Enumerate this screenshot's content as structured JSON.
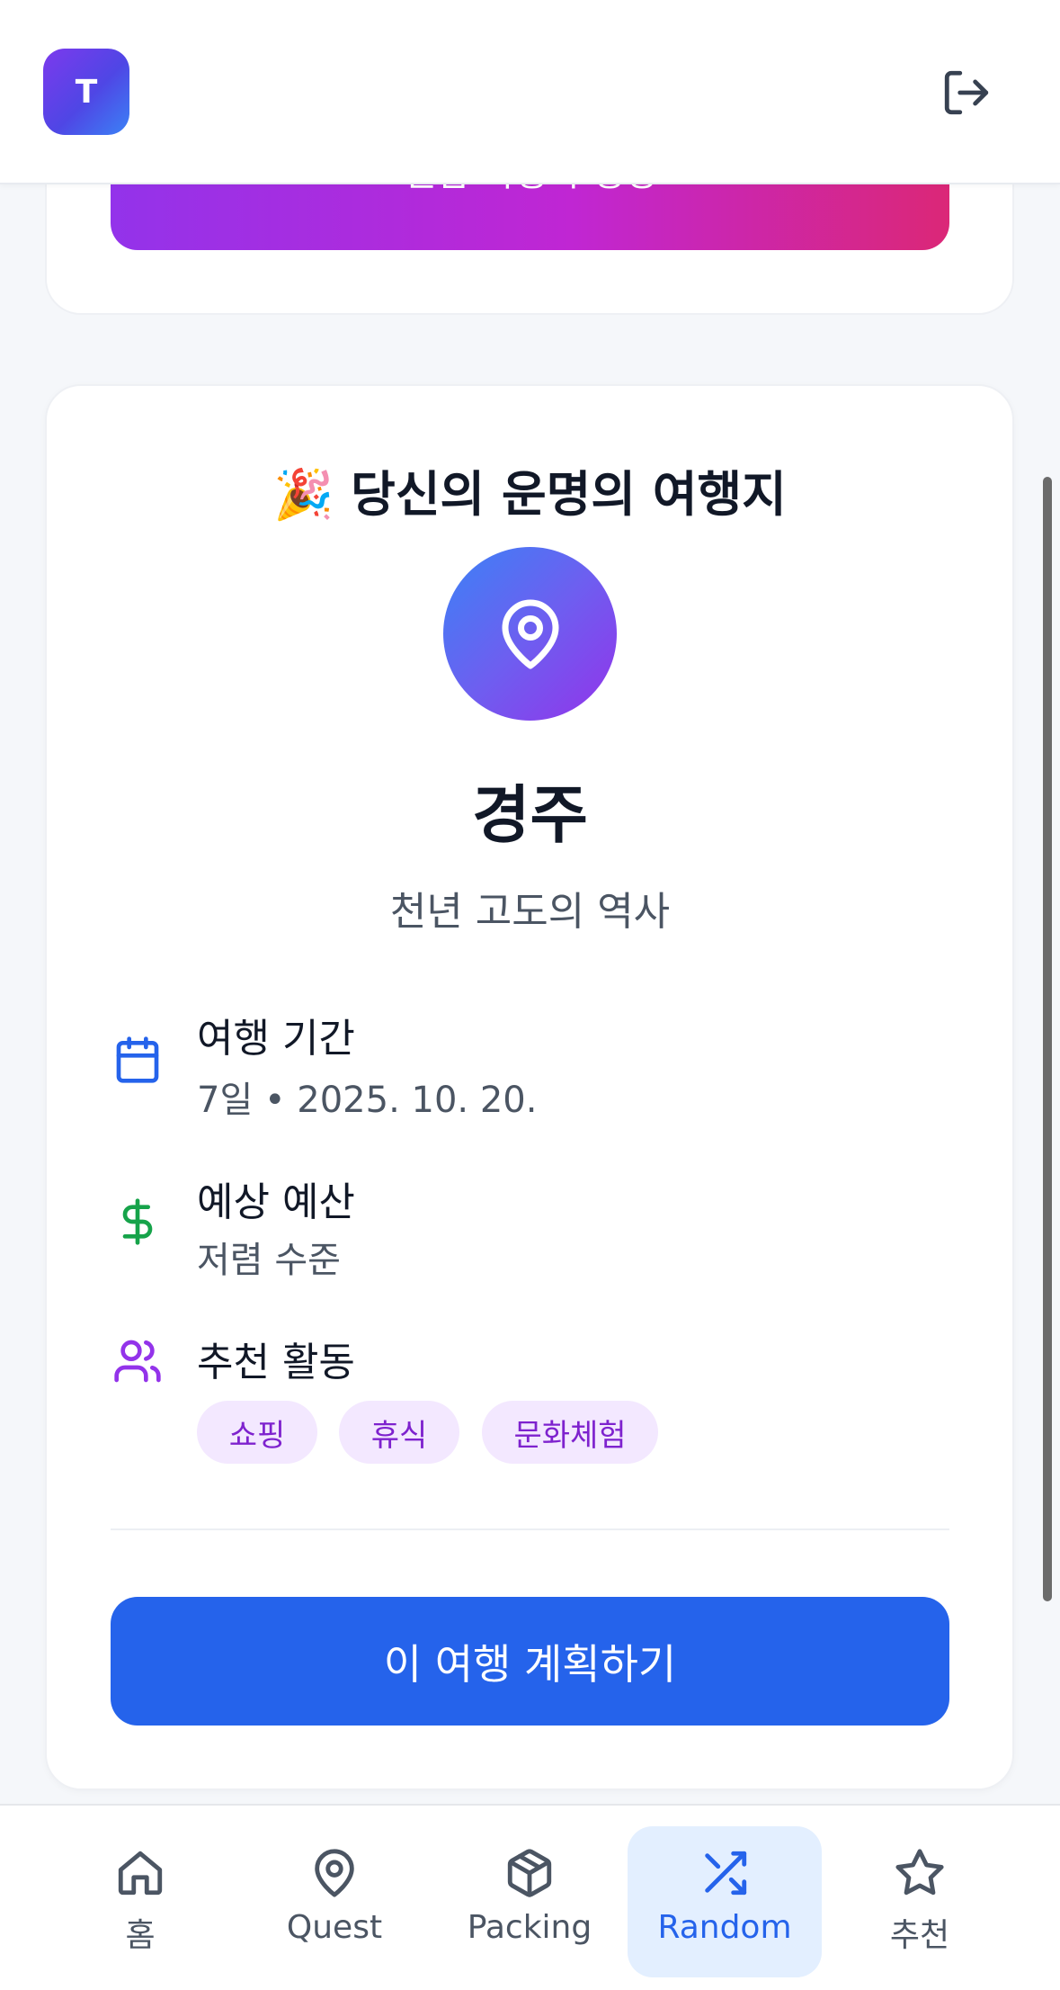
{
  "header": {
    "avatar_initial": "T",
    "logout_icon": "logout-icon"
  },
  "previous_card": {
    "button_label": "랜덤 여행지 생성"
  },
  "result": {
    "title": "🎉 당신의 운명의 여행지",
    "destination": "경주",
    "description": "천년 고도의 역사",
    "details": {
      "duration_label": "여행 기간",
      "duration_value": "7일 • 2025. 10. 20.",
      "budget_label": "예상 예산",
      "budget_value": "저렴 수준",
      "activities_label": "추천 활동"
    },
    "tags": [
      "쇼핑",
      "휴식",
      "문화체험"
    ],
    "plan_button": "이 여행 계획하기"
  },
  "nav": {
    "items": [
      {
        "label": "홈",
        "icon": "home-icon"
      },
      {
        "label": "Quest",
        "icon": "map-pin-icon"
      },
      {
        "label": "Packing",
        "icon": "package-icon"
      },
      {
        "label": "Random",
        "icon": "shuffle-icon",
        "active": true
      },
      {
        "label": "추천",
        "icon": "star-icon"
      }
    ]
  },
  "colors": {
    "primary": "#2563eb",
    "purple": "#9333ea",
    "pink": "#db2777",
    "green": "#16a34a",
    "tag_bg": "#f3e8ff",
    "tag_text": "#7e22ce"
  }
}
